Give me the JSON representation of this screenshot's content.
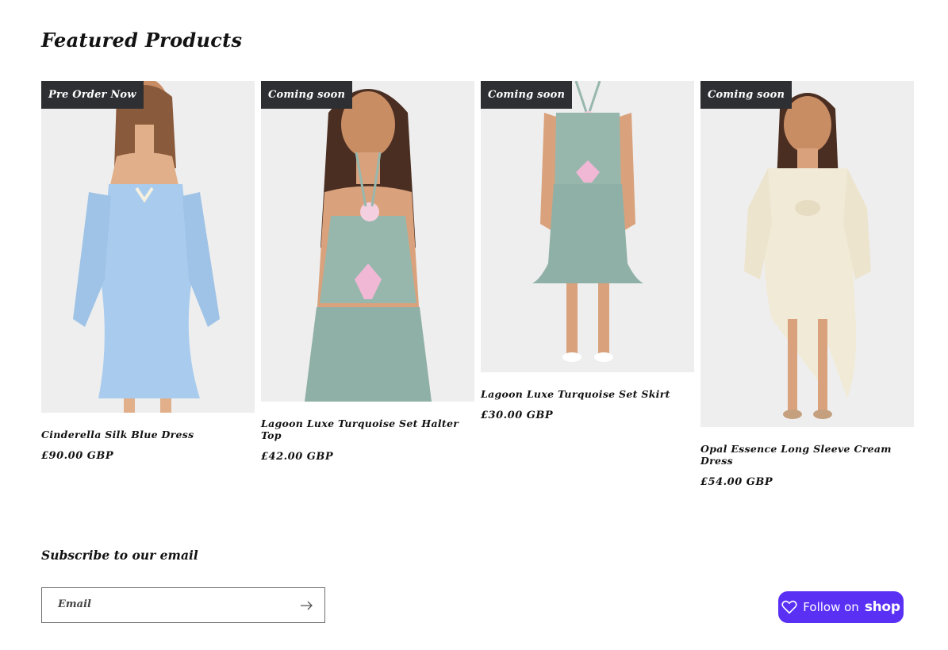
{
  "featured": {
    "heading": "Featured Products",
    "products": [
      {
        "badge": "Pre Order Now",
        "title": "Cinderella Silk Blue Dress",
        "price": "£90.00 GBP"
      },
      {
        "badge": "Coming soon",
        "title": "Lagoon Luxe Turquoise Set Halter Top",
        "price": "£42.00 GBP"
      },
      {
        "badge": "Coming soon",
        "title": "Lagoon Luxe Turquoise Set Skirt",
        "price": "£30.00 GBP"
      },
      {
        "badge": "Coming soon",
        "title": "Opal Essence Long Sleeve Cream Dress",
        "price": "£54.00 GBP"
      }
    ]
  },
  "newsletter": {
    "heading": "Subscribe to our email",
    "email_label": "Email",
    "email_value": ""
  },
  "shop_follow": {
    "label": "Follow on",
    "brand": "shop"
  },
  "colors": {
    "badge_background": "#2e2f33",
    "shop_button": "#5a31f4",
    "blue_dress": "#a9ccee",
    "turquoise_set": "#97b7ad",
    "cream_dress": "#f1ead7"
  }
}
